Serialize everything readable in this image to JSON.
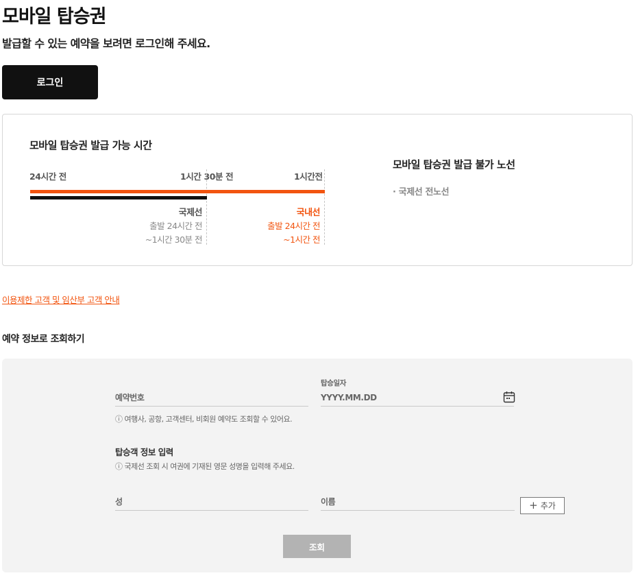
{
  "header": {
    "title": "모바일 탑승권",
    "subtitle": "발급할 수 있는 예약을 보려면 로그인해 주세요.",
    "login_label": "로그인"
  },
  "availability": {
    "title": "모바일 탑승권 발급 가능 시간",
    "timeline_labels": [
      "24시간 전",
      "1시간 30분 전",
      "1시간전"
    ],
    "international": {
      "name": "국제선",
      "line1": "출발 24시간 전",
      "line2": "~1시간 30분 전"
    },
    "domestic": {
      "name": "국내선",
      "line1": "출발 24시간 전",
      "line2": "~1시간 전"
    },
    "unavailable_title": "모바일 탑승권 발급 불가 노선",
    "unavailable_item": "· 국제선 전노선",
    "colors": {
      "accent": "#f2540f",
      "international_bar": "#111111"
    }
  },
  "restrict_link": "이용제한 고객 및 임산부 고객 안내",
  "lookup": {
    "section_title": "예약 정보로 조회하기",
    "booking_number_placeholder": "예약번호",
    "booking_hint": "ⓘ 여행사, 공항, 고객센터, 비회원 예약도 조회할 수 있어요.",
    "date_label": "탑승일자",
    "date_placeholder": "YYYY.MM.DD",
    "passenger_heading": "탑승객 정보 입력",
    "passenger_hint": "ⓘ 국제선 조회 시 여권에 기재된 영문 성명을 입력해 주세요.",
    "last_name_placeholder": "성",
    "first_name_placeholder": "이름",
    "add_label": "추가",
    "search_label": "조회"
  },
  "icons": [
    "calendar-icon",
    "plus-icon"
  ]
}
